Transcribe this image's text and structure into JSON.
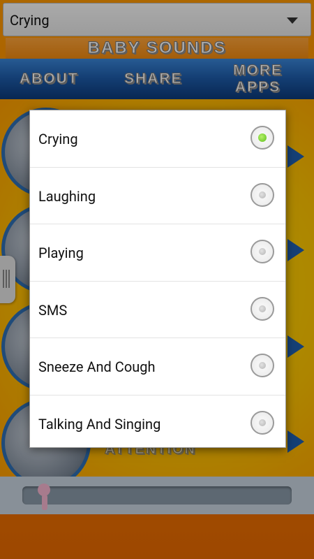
{
  "spinner": {
    "selected": "Crying"
  },
  "header": {
    "title": "BABY SOUNDS"
  },
  "nav": {
    "about": "ABOUT",
    "share": "SHARE",
    "more_line1": "MORE",
    "more_line2": "APPS"
  },
  "background": {
    "bottom_label": "ATTENTION"
  },
  "dialog": {
    "options": [
      {
        "label": "Crying",
        "checked": true
      },
      {
        "label": "Laughing",
        "checked": false
      },
      {
        "label": "Playing",
        "checked": false
      },
      {
        "label": "SMS",
        "checked": false
      },
      {
        "label": "Sneeze And Cough",
        "checked": false
      },
      {
        "label": "Talking And Singing",
        "checked": false
      }
    ]
  },
  "colors": {
    "accent_check": "#5bbf1a",
    "nav_blue": "#1d5aa8",
    "background_orange": "#ff8800"
  }
}
